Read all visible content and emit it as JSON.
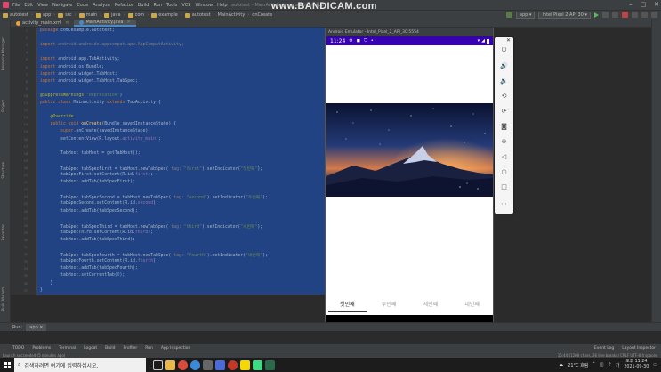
{
  "menubar": {
    "items": [
      "File",
      "Edit",
      "View",
      "Navigate",
      "Code",
      "Analyze",
      "Refactor",
      "Build",
      "Run",
      "Tools",
      "VCS",
      "Window",
      "Help"
    ],
    "title": "autotest – MainActivity.java [autotest.app]"
  },
  "watermark": {
    "prefix": "www.",
    "brand": "BANDICAM",
    "suffix": ".com"
  },
  "navbar": {
    "crumbs": [
      "autotest",
      "app",
      "src",
      "main",
      "java",
      "com",
      "example",
      "autotest",
      "MainActivity",
      "onCreate"
    ],
    "run_config": "app",
    "device": "Intel Pixel 2 API 30"
  },
  "tabs": [
    {
      "label": "activity_main.xml",
      "active": false
    },
    {
      "label": "MainActivity.java",
      "active": true
    }
  ],
  "leftstrip": {
    "labels": [
      "Resource Manager",
      "Project",
      "Structure",
      "Favorites",
      "Build Variants"
    ]
  },
  "code_lines": [
    {
      "n": "1",
      "html": "<span class=\"kw\">package</span> com.example.autotest;"
    },
    {
      "n": "2",
      "html": ""
    },
    {
      "n": "3",
      "html": "<span class=\"kw\">import</span> <span class=\"dim\">android.androidx.appcompat.app.AppCompatActivity;</span>"
    },
    {
      "n": "4",
      "html": ""
    },
    {
      "n": "5",
      "html": "<span class=\"kw\">import</span> android.app.TabActivity;"
    },
    {
      "n": "6",
      "html": "<span class=\"kw\">import</span> android.os.Bundle;"
    },
    {
      "n": "7",
      "html": "<span class=\"kw\">import</span> android.widget.TabHost;"
    },
    {
      "n": "8",
      "html": "<span class=\"kw\">import</span> android.widget.TabHost.TabSpec;"
    },
    {
      "n": "9",
      "html": ""
    },
    {
      "n": "10",
      "html": "<span class=\"ann\">@SuppressWarnings</span>(<span class=\"str\">\"deprecation\"</span>)"
    },
    {
      "n": "11",
      "html": "<span class=\"kw\">public class</span> MainActivity <span class=\"kw\">extends</span> TabActivity {"
    },
    {
      "n": "12",
      "html": ""
    },
    {
      "n": "13",
      "html": "    <span class=\"ann\">@Override</span>"
    },
    {
      "n": "14",
      "html": "    <span class=\"kw\">public void</span> <span class=\"fn\">onCreate</span>(Bundle savedInstanceState) {"
    },
    {
      "n": "15",
      "html": "        <span class=\"kw\">super</span>.onCreate(savedInstanceState);"
    },
    {
      "n": "16",
      "html": "        setContentView(R.layout.<span class=\"fld\">activity_main</span>);"
    },
    {
      "n": "17",
      "html": ""
    },
    {
      "n": "18",
      "html": "        TabHost tabHost = getTabHost();"
    },
    {
      "n": "19",
      "html": ""
    },
    {
      "n": "20",
      "html": "        TabSpec tabSpecFirst = tabHost.newTabSpec( <span class=\"dim\">tag:</span> <span class=\"str\">\"first\"</span>).setIndicator(<span class=\"str\">\"첫번째\"</span>);"
    },
    {
      "n": "21",
      "html": "        tabSpecFirst.setContent(R.id.<span class=\"fld\">first</span>);"
    },
    {
      "n": "22",
      "html": "        tabHost.addTab(tabSpecFirst);"
    },
    {
      "n": "23",
      "html": ""
    },
    {
      "n": "24",
      "html": "        TabSpec tabSpecSecond = tabHost.newTabSpec( <span class=\"dim\">tag:</span> <span class=\"str\">\"second\"</span>).setIndicator(<span class=\"str\">\"두번째\"</span>);"
    },
    {
      "n": "25",
      "html": "        tabSpecSecond.setContent(R.id.<span class=\"fld\">second</span>);"
    },
    {
      "n": "26",
      "html": "        tabHost.addTab(tabSpecSecond);"
    },
    {
      "n": "27",
      "html": ""
    },
    {
      "n": "28",
      "html": "        TabSpec tabSpecThird = tabHost.newTabSpec( <span class=\"dim\">tag:</span> <span class=\"str\">\"third\"</span>).setIndicator(<span class=\"str\">\"세번째\"</span>);"
    },
    {
      "n": "29",
      "html": "        tabSpecThird.setContent(R.id.<span class=\"fld\">third</span>);"
    },
    {
      "n": "30",
      "html": "        tabHost.addTab(tabSpecThird);"
    },
    {
      "n": "31",
      "html": ""
    },
    {
      "n": "32",
      "html": "        TabSpec tabSpecFourth = tabHost.newTabSpec( <span class=\"dim\">tag:</span> <span class=\"str\">\"fourth\"</span>).setIndicator(<span class=\"str\">\"네번째\"</span>);"
    },
    {
      "n": "33",
      "html": "        tabSpecFourth.setContent(R.id.<span class=\"fld\">fourth</span>);"
    },
    {
      "n": "34",
      "html": "        tabHost.addTab(tabSpecFourth);"
    },
    {
      "n": "35",
      "html": "        tabHost.setCurrentTab(<span class=\"num\">0</span>);"
    },
    {
      "n": "36",
      "html": "    }"
    },
    {
      "n": "37",
      "html": "}"
    }
  ],
  "emulator": {
    "title": "Android Emulator - Intel_Pixel_2_API_30:5554",
    "time": "11:24",
    "tabs": [
      "첫번째",
      "두번째",
      "세번째",
      "네번째"
    ],
    "selected_tab": 0
  },
  "emulator_tools": [
    "power-icon",
    "volume-up-icon",
    "volume-down-icon",
    "rotate-left-icon",
    "rotate-right-icon",
    "camera-icon",
    "zoom-icon",
    "back-icon",
    "home-icon",
    "overview-icon",
    "more-icon"
  ],
  "runpanel": {
    "label": "Run:",
    "tab": "app"
  },
  "bottomtools": {
    "left": [
      "TODO",
      "Problems",
      "Terminal",
      "Logcat",
      "Build",
      "Profiler",
      "Run",
      "App Inspection"
    ],
    "right": [
      "Event Log",
      "Layout Inspector"
    ]
  },
  "statusline": {
    "left": "Launch succeeded (5 minutes ago)",
    "right": "15:44 (1208 chars, 36 line breaks)  CRLF  UTF-8  4 spaces"
  },
  "taskbar": {
    "search_placeholder": "검색하려면 여기에 입력하십시오.",
    "weather": "21°C 흐림",
    "time": "오후 11:24",
    "date": "2021-09-30"
  }
}
